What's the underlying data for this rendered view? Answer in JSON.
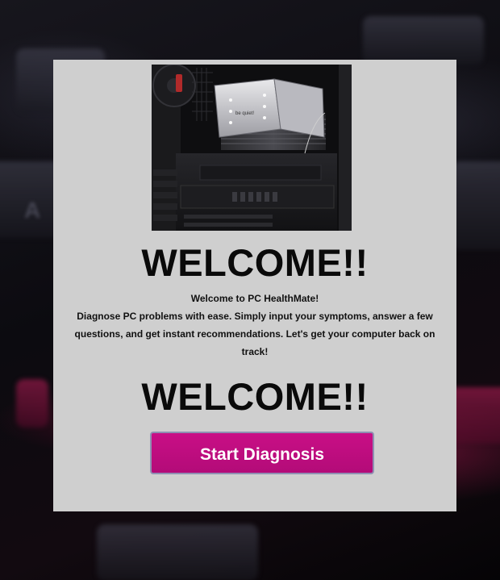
{
  "page": {
    "heading_primary": "WELCOME!!",
    "heading_secondary": "WELCOME!!"
  },
  "intro": {
    "title": "Welcome to PC HealthMate!",
    "body": "Diagnose PC problems with ease. Simply input your symptoms, answer a few questions, and get instant recommendations. Let's get your computer back on track!"
  },
  "hero_image": {
    "subject": "pc-internals-photo",
    "cooler_brand_text": "be quiet!"
  },
  "actions": {
    "start_label": "Start Diagnosis"
  },
  "colors": {
    "panel_background": "#cfcfcf",
    "button_background": "#c20f82",
    "button_border": "#8f8fb2",
    "heading_text": "#0a0a0a"
  }
}
